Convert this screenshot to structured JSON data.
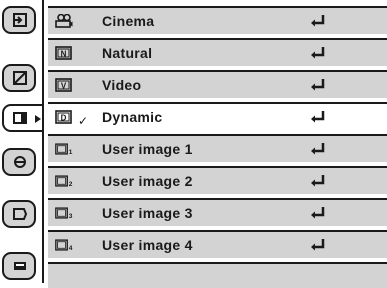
{
  "menu": {
    "items": [
      {
        "label": "Cinema",
        "icon": "film-camera-icon",
        "selected": false
      },
      {
        "label": "Natural",
        "icon": "n-box-icon",
        "box_letter": "N",
        "selected": false
      },
      {
        "label": "Video",
        "icon": "v-box-icon",
        "box_letter": "V",
        "selected": false
      },
      {
        "label": "Dynamic",
        "icon": "d-box-icon",
        "box_letter": "D",
        "selected": true,
        "check": "✓"
      },
      {
        "label": "User image 1",
        "icon": "user-image-icon",
        "subscript": "1",
        "selected": false
      },
      {
        "label": "User image 2",
        "icon": "user-image-icon",
        "subscript": "2",
        "selected": false
      },
      {
        "label": "User image 3",
        "icon": "user-image-icon",
        "subscript": "3",
        "selected": false
      },
      {
        "label": "User image 4",
        "icon": "user-image-icon",
        "subscript": "4",
        "selected": false
      }
    ]
  },
  "tabs": [
    {
      "icon": "input-icon"
    },
    {
      "icon": "image-adjust-icon"
    },
    {
      "icon": "image-select-icon",
      "active": true
    },
    {
      "icon": "screen-icon"
    },
    {
      "icon": "setting-icon"
    },
    {
      "icon": "info-icon"
    }
  ],
  "colors": {
    "row_bg": "#d3d3d3",
    "selected_bg": "#ffffff",
    "line": "#1a1a1a"
  }
}
